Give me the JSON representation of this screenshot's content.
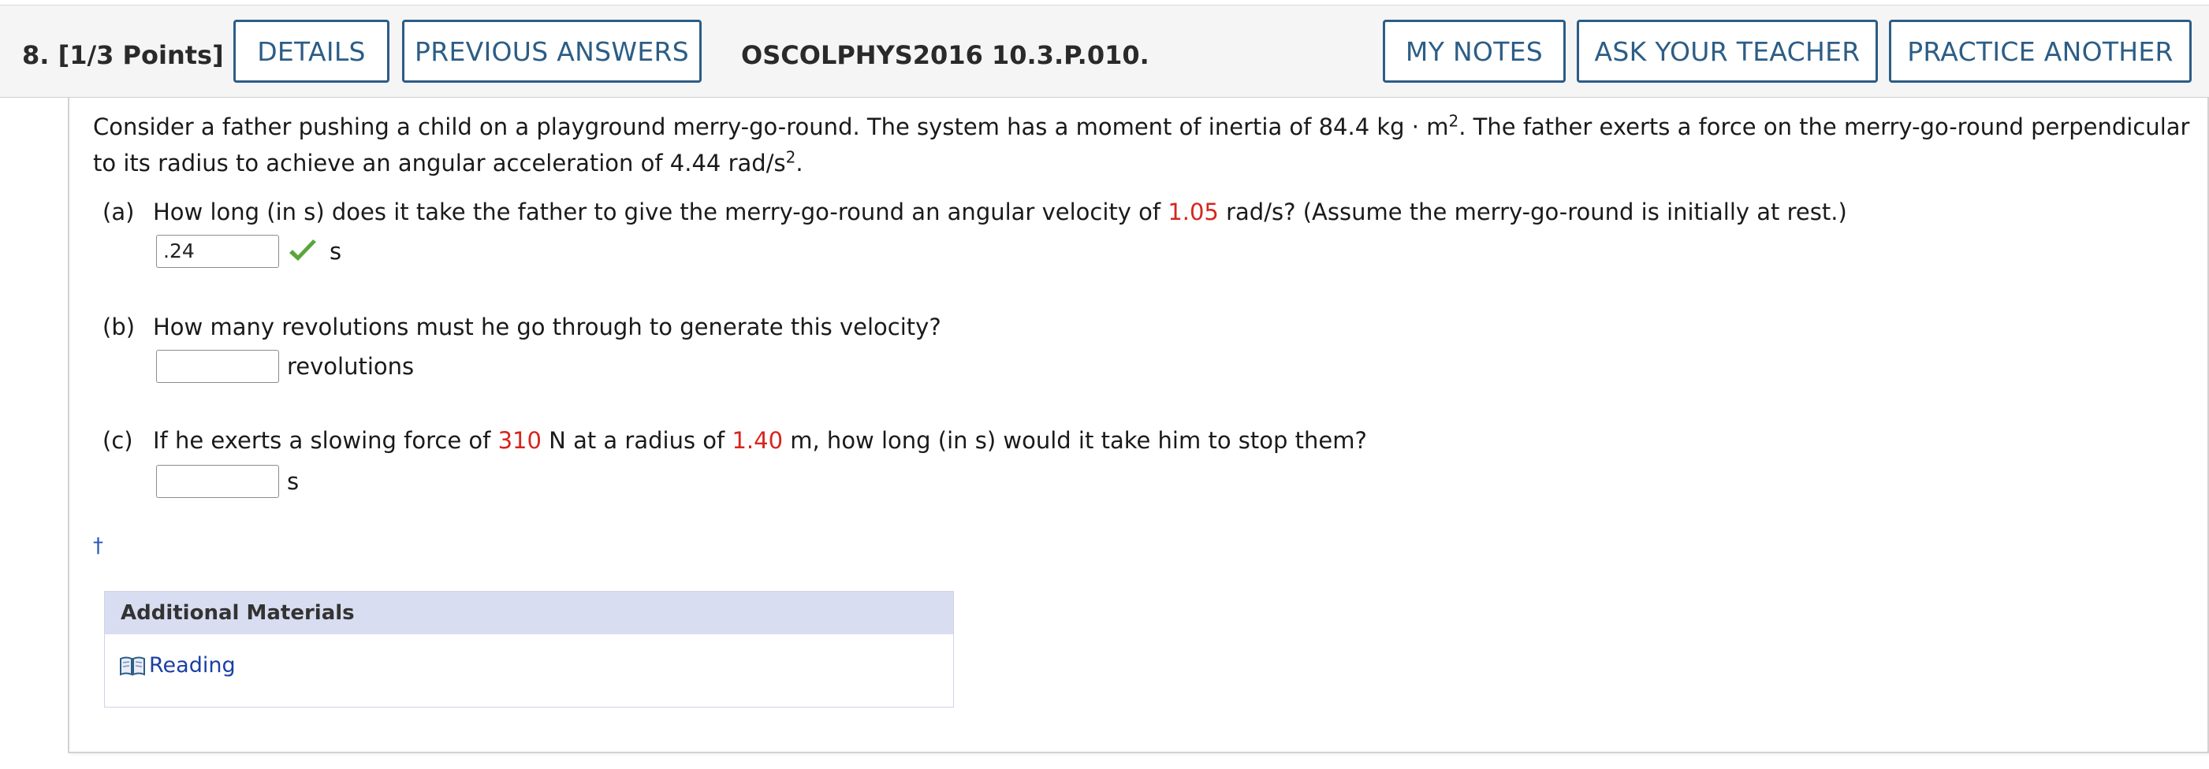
{
  "header": {
    "question_title": "8.  [1/3 Points]",
    "details_label": "DETAILS",
    "previous_answers_label": "PREVIOUS ANSWERS",
    "problem_code": "OSCOLPHYS2016 10.3.P.010.",
    "my_notes_label": "MY NOTES",
    "ask_teacher_label": "ASK YOUR TEACHER",
    "practice_another_label": "PRACTICE ANOTHER"
  },
  "problem": {
    "intro_1": "Consider a father pushing a child on a playground merry-go-round. The system has a moment of inertia of 84.4 kg · m",
    "intro_sup_1": "2",
    "intro_2": ". The father exerts a force on the merry-go-round perpendicular to its radius to achieve an angular acceleration of 4.44 rad/s",
    "intro_sup_2": "2",
    "intro_3": "."
  },
  "parts": {
    "a": {
      "label": "(a)",
      "text_before": "How long (in s) does it take the father to give the merry-go-round an angular velocity of ",
      "highlight": "1.05",
      "text_after": " rad/s? (Assume the merry-go-round is initially at rest.)",
      "answer_value": ".24",
      "answer_status": "correct",
      "unit": "s"
    },
    "b": {
      "label": "(b)",
      "text": "How many revolutions must he go through to generate this velocity?",
      "answer_value": "",
      "unit": "revolutions"
    },
    "c": {
      "label": "(c)",
      "text_1": "If he exerts a slowing force of ",
      "highlight_1": "310",
      "text_2": " N at a radius of ",
      "highlight_2": "1.40",
      "text_3": " m, how long (in s) would it take him to stop them?",
      "answer_value": "",
      "unit": "s"
    }
  },
  "footnote_mark": "†",
  "additional_materials": {
    "title": "Additional Materials",
    "reading_label": "Reading",
    "reading_icon": "book-icon"
  },
  "colors": {
    "button_accent": "#2c5d86",
    "highlight_red": "#d6251d",
    "correct_green": "#5aa53c",
    "materials_header_bg": "#d8ddf1",
    "link_blue": "#1a3fa6"
  }
}
